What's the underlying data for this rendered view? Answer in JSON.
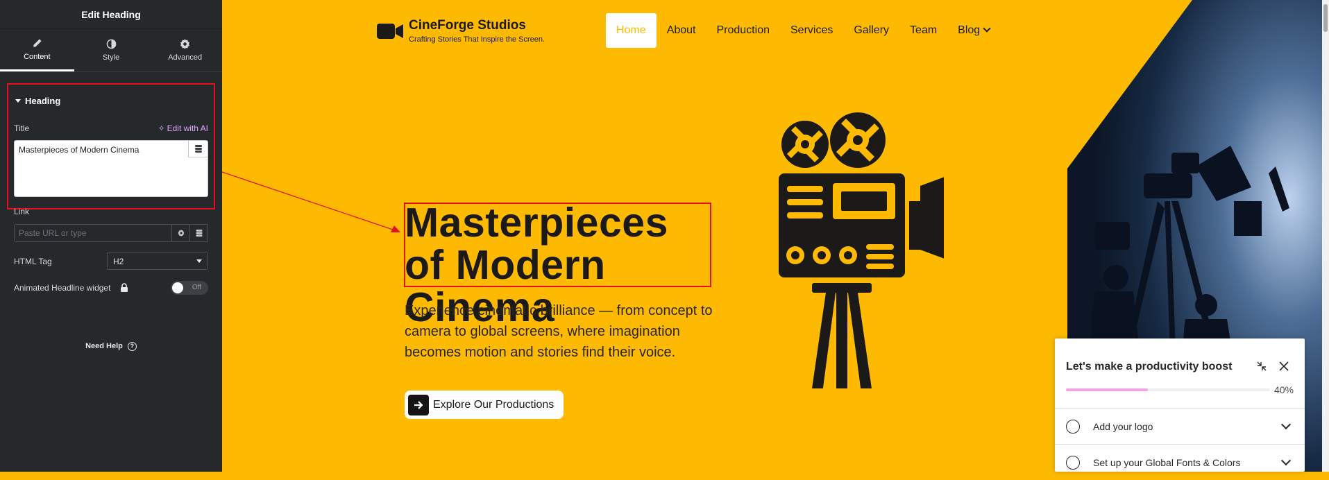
{
  "sidebar": {
    "title": "Edit Heading",
    "tabs": [
      {
        "label": "Content",
        "icon": "pencil-icon",
        "active": true
      },
      {
        "label": "Style",
        "icon": "half-circle-icon",
        "active": false
      },
      {
        "label": "Advanced",
        "icon": "gear-icon",
        "active": false
      }
    ],
    "section_title": "Heading",
    "title_label": "Title",
    "edit_ai_label": "Edit with AI",
    "title_value": "Masterpieces of Modern Cinema",
    "link_label": "Link",
    "link_placeholder": "Paste URL or type",
    "html_tag_label": "HTML Tag",
    "html_tag_value": "H2",
    "animated_label": "Animated Headline widget",
    "toggle_text": "Off",
    "need_help": "Need Help"
  },
  "site": {
    "brand_name": "CineForge Studios",
    "tagline": "Crafting Stories That Inspire the Screen.",
    "nav": [
      "Home",
      "About",
      "Production",
      "Services",
      "Gallery",
      "Team",
      "Blog"
    ],
    "active_nav": "Home",
    "hero_title": "Masterpieces of Modern Cinema",
    "hero_desc": "Experience cinematic brilliance — from concept to camera to global screens, where imagination becomes motion and stories find their voice.",
    "cta_label": "Explore Our Productions"
  },
  "checklist": {
    "title": "Let's make a productivity boost",
    "progress_percent": 40,
    "progress_text": "40%",
    "items": [
      "Add your logo",
      "Set up your Global Fonts & Colors"
    ]
  },
  "colors": {
    "accent": "#fdba00",
    "sidebar_bg": "#26292c",
    "highlight": "#e5101e",
    "ai_color": "#e3a6ff",
    "progress": "#f2a4e6"
  }
}
